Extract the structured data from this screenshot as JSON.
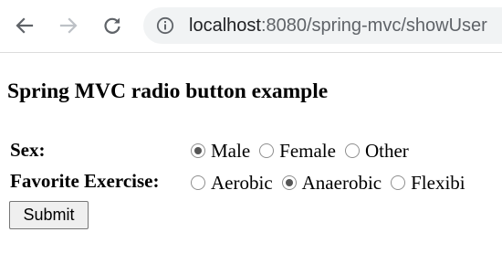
{
  "browser": {
    "back_icon": "arrow-left-icon",
    "forward_icon": "arrow-right-icon",
    "reload_icon": "reload-icon",
    "info_icon": "info-icon",
    "url_host": "localhost",
    "url_rest": ":8080/spring-mvc/showUser",
    "icon_color": "#5f6368",
    "disabled_icon_color": "#bdc1c6",
    "omnibox_color": "#f1f3f4"
  },
  "page": {
    "heading": "Spring MVC radio button example"
  },
  "form": {
    "sex": {
      "label": "Sex:",
      "options": [
        {
          "label": "Male",
          "checked": true
        },
        {
          "label": "Female",
          "checked": false
        },
        {
          "label": "Other",
          "checked": false
        }
      ]
    },
    "exercise": {
      "label": "Favorite Exercise:",
      "options": [
        {
          "label": "Aerobic",
          "checked": false
        },
        {
          "label": "Anaerobic",
          "checked": true
        },
        {
          "label": "Flexibi",
          "checked": false
        }
      ]
    },
    "submit_label": "Submit"
  }
}
